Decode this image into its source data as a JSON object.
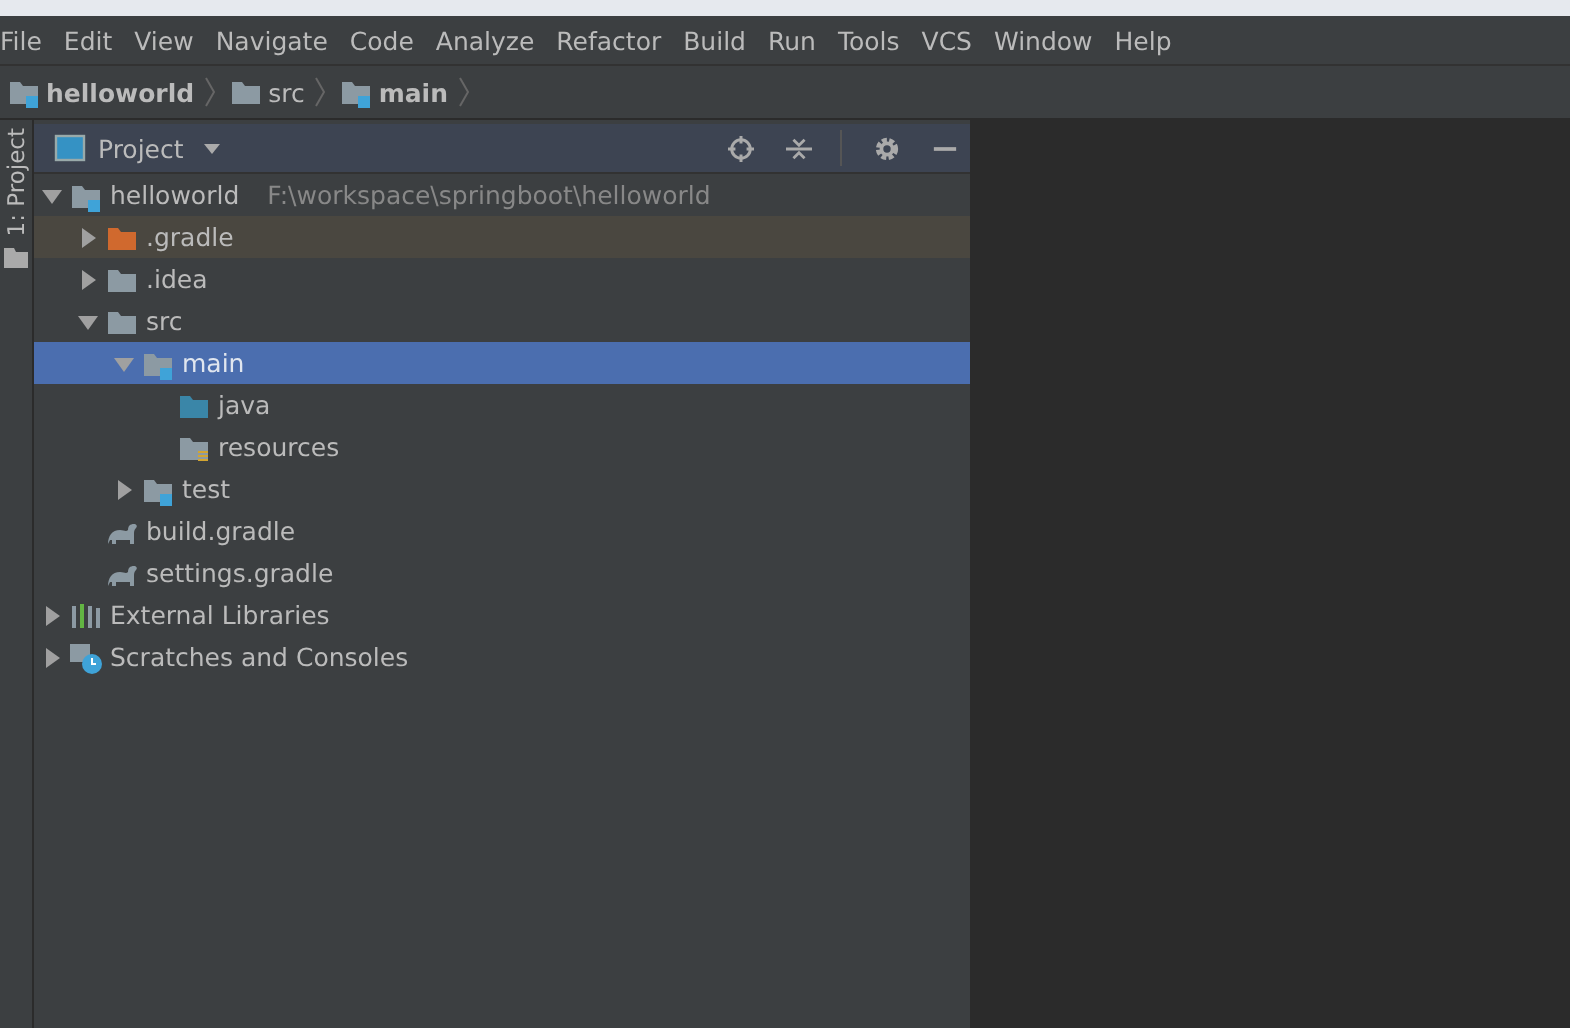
{
  "menu": [
    "File",
    "Edit",
    "View",
    "Navigate",
    "Code",
    "Analyze",
    "Refactor",
    "Build",
    "Run",
    "Tools",
    "VCS",
    "Window",
    "Help"
  ],
  "breadcrumb": [
    {
      "label": "helloworld",
      "kind": "module"
    },
    {
      "label": "src",
      "kind": "folder"
    },
    {
      "label": "main",
      "kind": "module"
    }
  ],
  "tool_strip": {
    "tab": "1: Project"
  },
  "project_panel": {
    "title": "Project",
    "tree": [
      {
        "label": "helloworld",
        "path": "F:\\workspace\\springboot\\helloworld",
        "kind": "module",
        "expanded": true,
        "selected": false,
        "children": [
          {
            "label": ".gradle",
            "kind": "excluded",
            "expanded": false,
            "selected": false
          },
          {
            "label": ".idea",
            "kind": "folder",
            "expanded": false,
            "selected": false
          },
          {
            "label": "src",
            "kind": "folder",
            "expanded": true,
            "selected": false,
            "children": [
              {
                "label": "main",
                "kind": "module",
                "expanded": true,
                "selected": true,
                "children": [
                  {
                    "label": "java",
                    "kind": "source",
                    "selected": false
                  },
                  {
                    "label": "resources",
                    "kind": "resources",
                    "selected": false
                  }
                ]
              },
              {
                "label": "test",
                "kind": "module",
                "expanded": false,
                "selected": false
              }
            ]
          },
          {
            "label": "build.gradle",
            "kind": "gradle",
            "selected": false
          },
          {
            "label": "settings.gradle",
            "kind": "gradle",
            "selected": false
          }
        ]
      },
      {
        "label": "External Libraries",
        "kind": "libraries",
        "expanded": false,
        "selected": false
      },
      {
        "label": "Scratches and Consoles",
        "kind": "scratches",
        "expanded": false,
        "selected": false
      }
    ]
  }
}
